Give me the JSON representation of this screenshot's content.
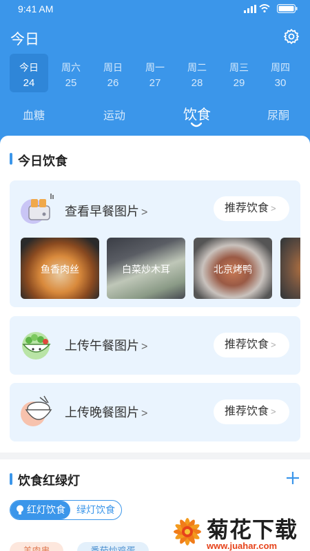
{
  "status_bar": {
    "time": "9:41 AM"
  },
  "header": {
    "title": "今日"
  },
  "days": [
    {
      "weekday": "今日",
      "date": "24",
      "selected": true
    },
    {
      "weekday": "周六",
      "date": "25"
    },
    {
      "weekday": "周日",
      "date": "26"
    },
    {
      "weekday": "周一",
      "date": "27"
    },
    {
      "weekday": "周二",
      "date": "28"
    },
    {
      "weekday": "周三",
      "date": "29"
    },
    {
      "weekday": "周四",
      "date": "30"
    }
  ],
  "tabs": [
    {
      "label": "血糖"
    },
    {
      "label": "运动"
    },
    {
      "label": "饮食",
      "active": true
    },
    {
      "label": "尿酮"
    }
  ],
  "diet": {
    "section_title": "今日饮食",
    "breakfast": {
      "label": "查看早餐图片",
      "recommend": "推荐饮食"
    },
    "photos": [
      {
        "caption": "鱼香肉丝"
      },
      {
        "caption": "白菜炒木耳"
      },
      {
        "caption": "北京烤鸭"
      }
    ],
    "lunch": {
      "label": "上传午餐图片",
      "recommend": "推荐饮食"
    },
    "dinner": {
      "label": "上传晚餐图片",
      "recommend": "推荐饮食"
    }
  },
  "traffic": {
    "section_title": "饮食红绿灯",
    "toggle_red": "红灯饮食",
    "toggle_green": "绿灯饮食",
    "chip_red": "羊肉串",
    "chip_green": "番茄炒鸡蛋"
  },
  "watermark": {
    "title": "菊花下载网",
    "url": "www.juahar.com"
  },
  "colors": {
    "primary": "#3b96ea",
    "card_bg": "#eaf4fe",
    "accent_orange": "#e6431b"
  }
}
